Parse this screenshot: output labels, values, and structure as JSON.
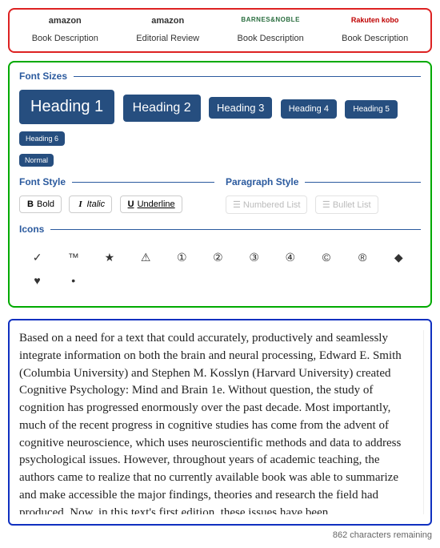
{
  "tabs": [
    {
      "logo": "amazon",
      "label": "Book Description",
      "logoClass": ""
    },
    {
      "logo": "amazon",
      "label": "Editorial Review",
      "logoClass": ""
    },
    {
      "logo": "BARNES&NOBLE",
      "label": "Book Description",
      "logoClass": "bn-logo"
    },
    {
      "logo": "Rakuten kobo",
      "label": "Book Description",
      "logoClass": "kobo-logo"
    }
  ],
  "sections": {
    "fontSizes": "Font Sizes",
    "fontStyle": "Font Style",
    "paragraphStyle": "Paragraph Style",
    "icons": "Icons"
  },
  "headingButtons": {
    "h1": "Heading 1",
    "h2": "Heading 2",
    "h3": "Heading 3",
    "h4": "Heading 4",
    "h5": "Heading 5",
    "h6": "Heading 6",
    "normal": "Normal"
  },
  "fontStyleButtons": {
    "bold": "Bold",
    "italic": "Italic",
    "underline": "Underline"
  },
  "paragraphButtons": {
    "numbered": "Numbered List",
    "bullet": "Bullet List"
  },
  "iconGlyphs": [
    "✓",
    "™",
    "★",
    "⚠",
    "①",
    "②",
    "③",
    "④",
    "©",
    "®",
    "◆",
    "♥",
    "•"
  ],
  "editorText": "Based on a need for a text that could accurately, productively and seamlessly integrate information on both the brain and neural processing, Edward E. Smith (Columbia University) and Stephen M. Kosslyn (Harvard University) created Cognitive Psychology: Mind and Brain 1e. Without question, the study of cognition has progressed enormously over the past decade. Most importantly, much of the recent progress in cognitive studies has come from the advent of cognitive neuroscience, which uses neuroscientific methods and data to address psychological issues. However, throughout years of academic teaching, the authors came to realize that no currently available book was able to summarize and make accessible the major findings, theories and research the field had produced. Now, in this text's first edition, these issues have been",
  "charCount": "862 characters remaining"
}
